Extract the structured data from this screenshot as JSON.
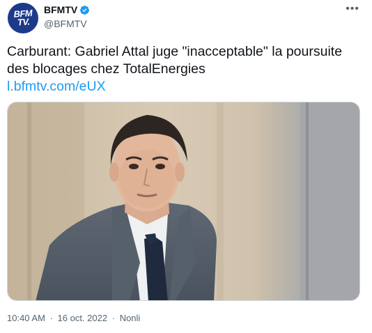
{
  "account": {
    "display_name": "BFMTV",
    "handle": "@BFMTV",
    "avatar_text": "BFM TV.",
    "verified": true
  },
  "tweet": {
    "text": "Carburant: Gabriel Attal juge \"inacceptable\" la poursuite des blocages chez TotalEnergies",
    "link": "l.bfmtv.com/eUX"
  },
  "meta": {
    "time": "10:40 AM",
    "sep": "·",
    "date": "16 oct. 2022",
    "sep2": "·",
    "source": "Nonli"
  },
  "icons": {
    "verified": "verified-badge-icon",
    "more": "more-options-icon"
  },
  "colors": {
    "accent": "#1d9bf0",
    "avatar_bg": "#1d3a8a",
    "muted": "#536471"
  }
}
